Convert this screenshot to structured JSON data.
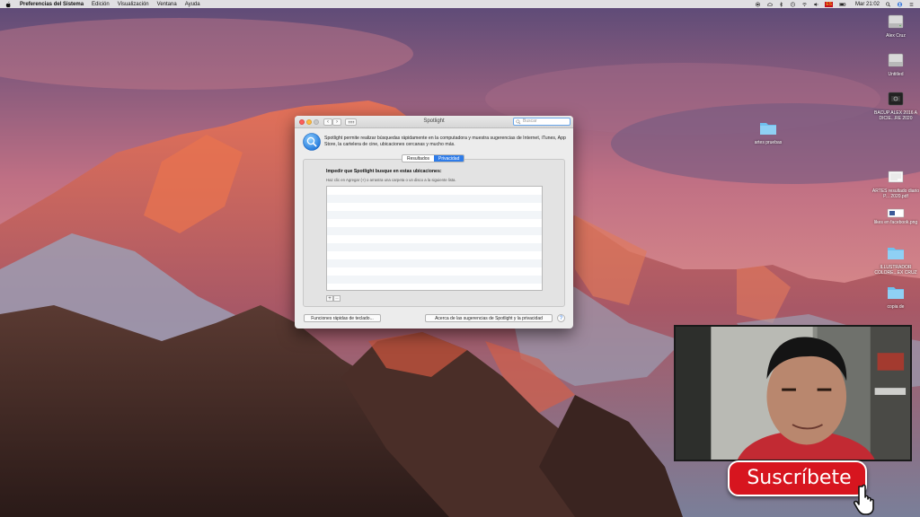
{
  "menubar": {
    "app_name": "Preferencias del Sistema",
    "items": [
      "Edición",
      "Visualización",
      "Ventana",
      "Ayuda"
    ],
    "input_source": "ES",
    "clock": "Mar 21:02"
  },
  "desktop": {
    "icons": [
      {
        "label": "Alex Cruz",
        "icon": "hard-drive-icon"
      },
      {
        "label": "Untitled",
        "icon": "hard-drive-icon"
      },
      {
        "label": "BACUP ALEX 2016 A DICIE...RE 2020",
        "icon": "external-drive-icon"
      },
      {
        "label": "artes pruebas",
        "icon": "folder-icon"
      },
      {
        "label": "ARTES resultado diario P... 2020.pdf",
        "icon": "pdf-document-icon"
      },
      {
        "label": "likes en facebook.png",
        "icon": "image-file-icon"
      },
      {
        "label": "ILLUSTRADOR COLORE...EX CRUZ",
        "icon": "folder-icon"
      },
      {
        "label": "copia de",
        "icon": "folder-icon"
      }
    ]
  },
  "window": {
    "title": "Spotlight",
    "search_placeholder": "Buscar",
    "description": "Spotlight permite realizar búsquedas rápidamente en la computadora y muestra sugerencias de Internet, iTunes, App Store, la cartelera de cine, ubicaciones cercanas y mucho más.",
    "tabs": [
      "Resultados",
      "Privacidad"
    ],
    "active_tab": "Privacidad",
    "privacy": {
      "heading": "Impedir que Spotlight busque en estas ubicaciones:",
      "hint": "Haz clic en Agregar (+) o arrastra una carpeta o un disco a la siguiente lista."
    },
    "list_add_label": "+",
    "list_remove_label": "–",
    "shortcuts_button": "Funciones rápidas de teclado...",
    "about_button": "Acerca de las sugerencias de Spotlight y la privacidad",
    "help_label": "?"
  },
  "overlay": {
    "subscribe_label": "Suscríbete"
  },
  "colors": {
    "accent": "#2f7ce8",
    "subscribe_red": "#d7151f"
  }
}
